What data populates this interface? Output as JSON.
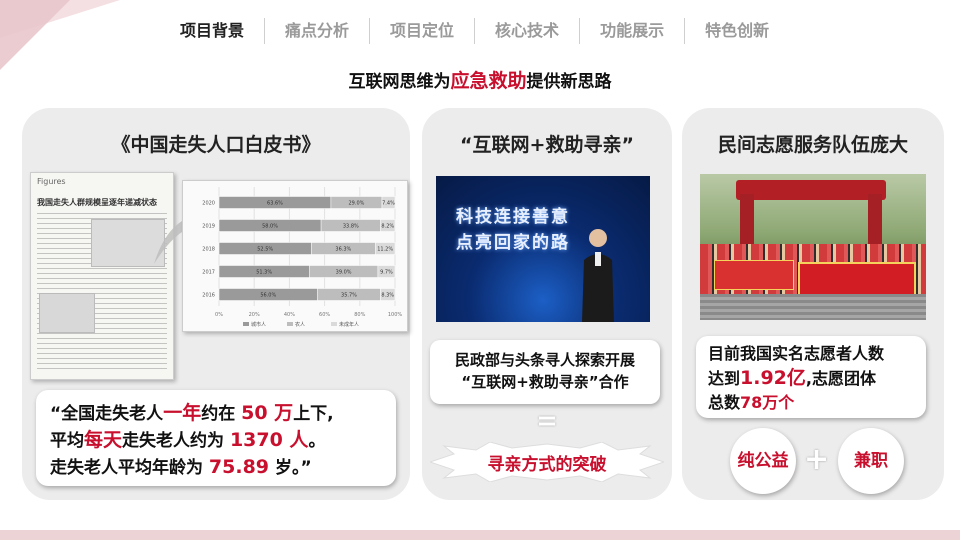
{
  "nav": {
    "items": [
      {
        "label": "项目背景",
        "active": true
      },
      {
        "label": "痛点分析",
        "active": false
      },
      {
        "label": "项目定位",
        "active": false
      },
      {
        "label": "核心技术",
        "active": false
      },
      {
        "label": "功能展示",
        "active": false
      },
      {
        "label": "特色创新",
        "active": false
      }
    ]
  },
  "headline": {
    "prefix": "互联网思维为",
    "highlight": "应急救助",
    "suffix": "提供新思路"
  },
  "panel1": {
    "title": "《中国走失人口白皮书》",
    "newspaper_masthead": "Figures",
    "newspaper_headline": "我国走失人群规模呈逐年递减状态",
    "quote": {
      "l1a": "“全国走失老人",
      "l1b": "一年",
      "l1c": "约在 ",
      "l1d": "50 万",
      "l1e": "上下,",
      "l2a": "平均",
      "l2b": "每天",
      "l2c": "走失老人约为 ",
      "l2d": "1370 人",
      "l2e": "。",
      "l3a": "走失老人平均年龄为 ",
      "l3b": "75.89",
      "l3c": " 岁。”"
    }
  },
  "chart_data": {
    "type": "bar",
    "orientation": "horizontal",
    "stacked": true,
    "categories": [
      "2020",
      "2019",
      "2018",
      "2017",
      "2016"
    ],
    "series": [
      {
        "name": "城市人",
        "values": [
          63.6,
          58.0,
          52.5,
          51.3,
          56.0
        ]
      },
      {
        "name": "农人",
        "values": [
          29.0,
          33.8,
          36.3,
          39.0,
          35.7
        ]
      },
      {
        "name": "未成年人",
        "values": [
          7.4,
          8.2,
          11.2,
          9.7,
          8.3
        ]
      }
    ],
    "value_labels": [
      [
        "63.6%",
        "29.0%",
        "7.4%"
      ],
      [
        "58.0%",
        "33.8%",
        "8.2%"
      ],
      [
        "52.5%",
        "36.3%",
        "11.2%"
      ],
      [
        "51.3%",
        "39.0%",
        "9.7%"
      ],
      [
        "56.0%",
        "35.7%",
        "8.3%"
      ]
    ],
    "x_ticks": [
      "0%",
      "20%",
      "40%",
      "60%",
      "80%",
      "100%"
    ],
    "xlim": [
      0,
      100
    ],
    "colors": [
      "#9a9a9a",
      "#bdbdbd",
      "#dadada"
    ],
    "legend_position": "bottom"
  },
  "panel2": {
    "title": "“互联网+救助寻亲”",
    "stage_line1": "科技连接善意",
    "stage_line2": "点亮回家的路",
    "caption_line1": "民政部与头条寻人探索开展",
    "caption_line2": "“互联网+救助寻亲”合作",
    "equals": "=",
    "burst_label": "寻亲方式的突破"
  },
  "panel3": {
    "title": "民间志愿服务队伍庞大",
    "caption": {
      "a": "目前我国实名志愿者人数",
      "b": "达到",
      "c": "1.92亿",
      "d": ",志愿团体",
      "e": "总数",
      "f": "78万个"
    },
    "circle_left": "纯公益",
    "plus": "+",
    "circle_right": "兼职"
  },
  "colors": {
    "accent": "#c8102e",
    "panel_bg": "#ececec",
    "nav_inactive": "#9a9a9a"
  }
}
